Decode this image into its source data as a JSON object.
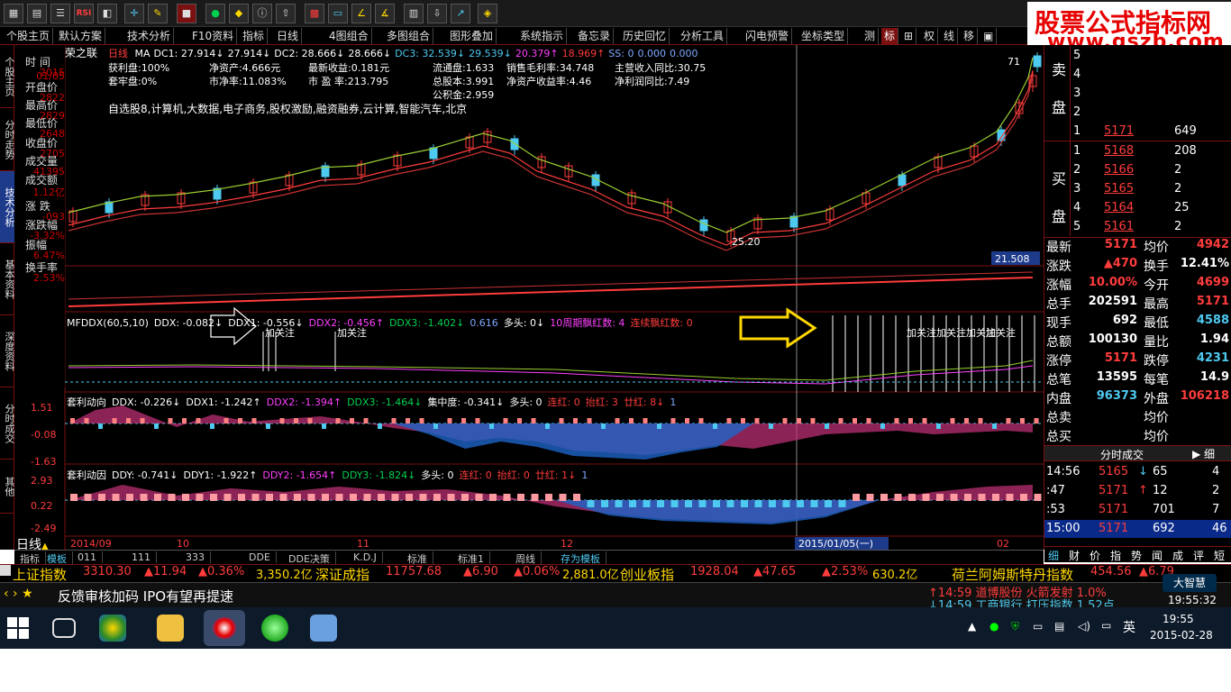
{
  "toolbar": {
    "rsi_label": "RSI",
    "menu": [
      "个股主页",
      "默认方案",
      "技术分析",
      "F10资料",
      "指标",
      "日线",
      "4图组合",
      "多图组合",
      "图形叠加",
      "系统指示",
      "备忘录",
      "历史回忆",
      "分析工具",
      "闪电预警",
      "坐标类型",
      "测",
      "标",
      "⊞",
      "权",
      "线",
      "移",
      "▣"
    ]
  },
  "brand": {
    "line1": "股票公式指标网",
    "line2": "www.gszb.com"
  },
  "left_nav": [
    "个股主页",
    "分时走势",
    "技术分析",
    "基本资料",
    "深度资料",
    "分时成交",
    "其他"
  ],
  "stock": {
    "name": "荣之联",
    "period": "日线",
    "ma_line": [
      "MA",
      "DC1: 27.914↓",
      "27.914↓",
      "DC2: 28.666↓",
      "28.666↓",
      "DC3: 32.539↓",
      "29.539↓",
      "20.379↑",
      "18.969↑",
      "SS: 0",
      "0.000",
      "0.000"
    ]
  },
  "fundamentals": [
    [
      "获利盘:100%",
      "净资产:4.666元",
      "最新收益:0.181元",
      "流通盘:1.633",
      "销售毛利率:34.748",
      "主营收入同比:30.75"
    ],
    [
      "套牢盘:0%",
      "市净率:11.083%",
      "市 盈 率:213.795",
      "总股本:3.991",
      "净资产收益率:4.46",
      "净利润同比:7.49"
    ],
    [
      "",
      "",
      "",
      "公积金:2.959",
      "",
      ""
    ]
  ],
  "concepts": "自选股8,计算机,大数据,电子商务,股权激励,融资融券,云计算,智能汽车,北京",
  "info_panel": [
    {
      "k": "时 间",
      "v": "2015"
    },
    {
      "k": "",
      "v": "01/05"
    },
    {
      "k": "开盘价",
      "v": "2822"
    },
    {
      "k": "最高价",
      "v": "2829"
    },
    {
      "k": "最低价",
      "v": "2648"
    },
    {
      "k": "收盘价",
      "v": "2705"
    },
    {
      "k": "成交量",
      "v": "41395"
    },
    {
      "k": "成交额",
      "v": "1.12亿"
    },
    {
      "k": "涨 跌",
      "v": "-093"
    },
    {
      "k": "涨跌幅",
      "v": "-3.32%"
    },
    {
      "k": "振幅",
      "v": "6.47%"
    },
    {
      "k": "换手率",
      "v": "2.53%"
    }
  ],
  "chart_marks": {
    "low_label": "25.20",
    "high_label": "71",
    "volume_tag": "21.508",
    "cursor_date": "2015/01/05(一)"
  },
  "ddx_header": [
    "MFDDX(60,5,10)",
    "DDX: -0.082↓",
    "DDX1: -0.556↓",
    "DDX2: -0.456↑",
    "DDX3: -1.402↓",
    "0.616",
    "多头: 0↓",
    "10周期飘红数: 4",
    "连续飘红数: 0"
  ],
  "ddx_marks": [
    "加关注",
    "加关注",
    "加关注加关注加关注",
    "加关注"
  ],
  "tlds_header": [
    "套利动向",
    "DDX: -0.226↓",
    "DDX1: -1.242↑",
    "DDX2: -1.394↑",
    "DDX3: -1.464↓",
    "集中度: -0.341↓",
    "多头: 0",
    "连红: 0",
    "抬红: 3",
    "廿红: 8↓",
    "1"
  ],
  "tlds_axis": [
    "1.51",
    "-0.08",
    "-1.63"
  ],
  "tlyy_header": [
    "套利动因",
    "DDY: -0.741↓",
    "DDY1: -1.922↑",
    "DDY2: -1.654↑",
    "DDY3: -1.824↓",
    "多头: 0",
    "连红: 0",
    "抬红: 0",
    "廿红: 1↓",
    "1"
  ],
  "tlyy_axis": [
    "2.93",
    "0.22",
    "-2.49"
  ],
  "x_axis": [
    "2014/09",
    "10",
    "11",
    "12",
    "2015/01/05(一)",
    "02"
  ],
  "period_label": "日线",
  "bottom_tabs": [
    "指标",
    "模板",
    "011",
    "111",
    "333",
    "DDE",
    "DDE决策",
    "K.D.J",
    "标准",
    "标准1",
    "周线",
    "存为模板"
  ],
  "quote": {
    "sell": [
      {
        "n": "5",
        "p": "",
        "v": ""
      },
      {
        "n": "4",
        "p": "",
        "v": ""
      },
      {
        "n": "3",
        "p": "",
        "v": ""
      },
      {
        "n": "2",
        "p": "",
        "v": ""
      },
      {
        "n": "1",
        "p": "5171",
        "v": "649"
      }
    ],
    "buy": [
      {
        "n": "1",
        "p": "5168",
        "v": "208"
      },
      {
        "n": "2",
        "p": "5166",
        "v": "2"
      },
      {
        "n": "3",
        "p": "5165",
        "v": "2"
      },
      {
        "n": "4",
        "p": "5164",
        "v": "25"
      },
      {
        "n": "5",
        "p": "5161",
        "v": "2"
      }
    ],
    "sell_label": [
      "卖",
      "盘"
    ],
    "buy_label": [
      "买",
      "盘"
    ],
    "stats": [
      [
        "最新",
        "5171",
        "均价",
        "4942"
      ],
      [
        "涨跌",
        "▲470",
        "换手",
        "12.41%"
      ],
      [
        "涨幅",
        "10.00%",
        "今开",
        "4699"
      ],
      [
        "总手",
        "202591",
        "最高",
        "5171"
      ],
      [
        "现手",
        "692",
        "最低",
        "4588"
      ],
      [
        "总额",
        "100130",
        "量比",
        "1.94"
      ],
      [
        "涨停",
        "5171",
        "跌停",
        "4231"
      ],
      [
        "总笔",
        "13595",
        "每笔",
        "14.9"
      ],
      [
        "内盘",
        "96373",
        "外盘",
        "106218"
      ],
      [
        "总卖",
        "",
        "均价",
        ""
      ],
      [
        "总买",
        "",
        "均价",
        ""
      ]
    ],
    "ticks_title": "分时成交",
    "ticks": [
      {
        "t": "14:56",
        "p": "5165",
        "d": "↓",
        "v": "65",
        "n": "4"
      },
      {
        "t": ":47",
        "p": "5171",
        "d": "↑",
        "v": "12",
        "n": "2"
      },
      {
        "t": ":53",
        "p": "5171",
        "d": "",
        "v": "701",
        "n": "7"
      },
      {
        "t": "15:00",
        "p": "5171",
        "d": "",
        "v": "692",
        "n": "46"
      }
    ],
    "tabs": [
      "细",
      "财",
      "价",
      "指",
      "势",
      "闻",
      "成",
      "评",
      "短"
    ]
  },
  "index_bar": [
    {
      "name": "上证指数",
      "val": "3310.30",
      "chg": "▲11.94",
      "pct": "▲0.36%",
      "amt": "3,350.2亿"
    },
    {
      "name": "深证成指",
      "val": "11757.68",
      "chg": "▲6.90",
      "pct": "▲0.06%",
      "amt": "2,881.0亿"
    },
    {
      "name": "创业板指",
      "val": "1928.04",
      "chg": "▲47.65",
      "pct": "▲2.53%",
      "amt": "630.2亿"
    },
    {
      "name": "荷兰阿姆斯特丹指数",
      "val": "454.56",
      "chg": "▲6.79",
      "pct": "",
      "amt": ""
    }
  ],
  "news": {
    "text": "反馈审核加码 IPO有望再提速",
    "alert1": "↑14:59 道博股份 火箭发射 1.0%",
    "alert2": "↓14:59 工商银行 打压指数 1.52点",
    "logo": "大智慧",
    "clock": "19:55:32"
  },
  "taskbar": {
    "ime": "英",
    "time": "19:55",
    "date": "2015-02-28"
  },
  "colors": {
    "up": "#ff3c3c",
    "down": "#4ec9f0",
    "bg": "#000000",
    "accent": "#7a1010"
  }
}
